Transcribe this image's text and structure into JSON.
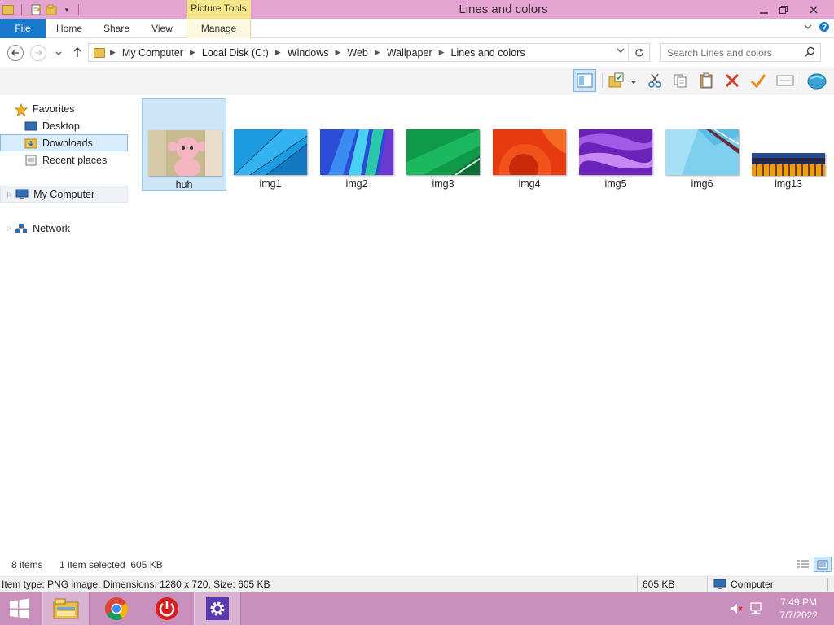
{
  "window": {
    "title": "Lines and colors",
    "context_tab": "Picture Tools",
    "minimize_icon": "minimize-icon",
    "maximize_icon": "restore-icon",
    "close_icon": "close-icon"
  },
  "ribbon": {
    "tabs": [
      "File",
      "Home",
      "Share",
      "View",
      "Manage"
    ]
  },
  "address": {
    "crumbs": [
      "My Computer",
      "Local Disk (C:)",
      "Windows",
      "Web",
      "Wallpaper",
      "Lines and colors"
    ]
  },
  "search": {
    "placeholder": "Search Lines and colors"
  },
  "navpane": {
    "favorites": "Favorites",
    "desktop": "Desktop",
    "downloads": "Downloads",
    "recent": "Recent places",
    "computer": "My Computer",
    "network": "Network"
  },
  "files": [
    {
      "name": "huh"
    },
    {
      "name": "img1"
    },
    {
      "name": "img2"
    },
    {
      "name": "img3"
    },
    {
      "name": "img4"
    },
    {
      "name": "img5"
    },
    {
      "name": "img6"
    },
    {
      "name": "img13"
    }
  ],
  "status": {
    "count": "8 items",
    "selection": "1 item selected  605 KB",
    "details": "Item type: PNG image, Dimensions: 1280 x 720, Size: 605 KB",
    "size": "605 KB",
    "location": "Computer"
  },
  "clock": {
    "time": "7:49 PM",
    "date": "7/7/2022"
  },
  "colors": {
    "titlebar": "#e6a4d2",
    "file_tab": "#1979ca",
    "taskbar": "#c98fbd",
    "selection": "#cde6f7"
  }
}
